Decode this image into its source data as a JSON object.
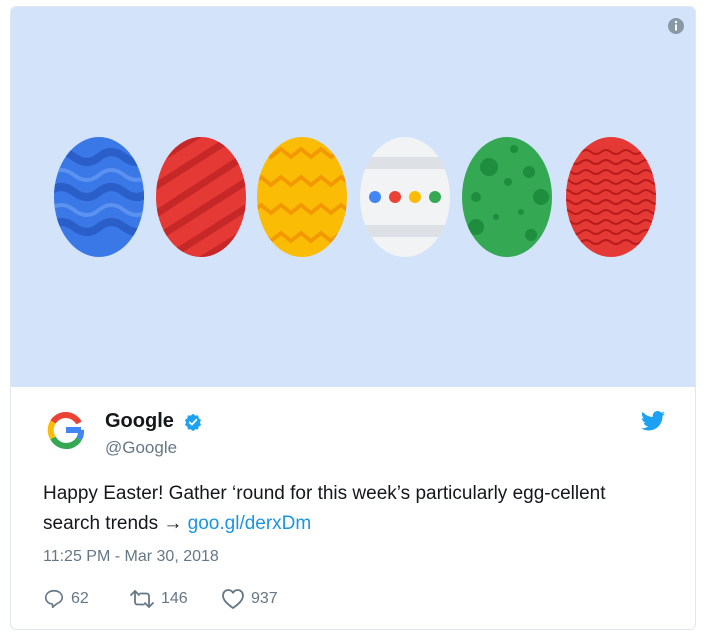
{
  "tweet": {
    "author_name": "Google",
    "author_handle": "@Google",
    "text_before_link": "Happy Easter! Gather ‘round for this week’s particularly egg-cellent search trends → ",
    "link_text": "goo.gl/derxDm",
    "timestamp": "11:25 PM - Mar 30, 2018"
  },
  "actions": {
    "replies": "62",
    "retweets": "146",
    "likes": "937"
  },
  "media": {
    "background": "#d3e3fa",
    "eggs": [
      {
        "name": "blue-wave-egg",
        "color": "#3b78e7"
      },
      {
        "name": "red-striped-egg",
        "color": "#e53935"
      },
      {
        "name": "yellow-zigzag-egg",
        "color": "#fbbc05"
      },
      {
        "name": "white-google-dots-egg",
        "color": "#f1f3f4"
      },
      {
        "name": "green-spotted-egg",
        "color": "#34a853"
      },
      {
        "name": "red-wavy-egg",
        "color": "#e53935"
      }
    ]
  },
  "icons": {
    "info": "info-icon",
    "verified": "verified-badge-icon",
    "bird": "twitter-bird-icon",
    "reply": "reply-icon",
    "retweet": "retweet-icon",
    "like": "heart-icon"
  },
  "colors": {
    "link": "#1b95e0",
    "verified": "#1da1f2",
    "muted": "#657786"
  }
}
